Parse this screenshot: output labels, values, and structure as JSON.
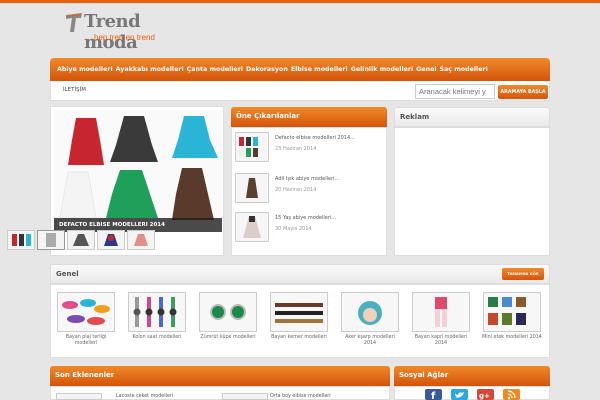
{
  "header": {
    "logo_title": "Trend moda",
    "logo_tagline": "hep tren en trend"
  },
  "nav": {
    "items": [
      "Abiye modelleri",
      "Ayakkabı modelleri",
      "Çanta modelleri",
      "Dekorasyon",
      "Elbise modelleri",
      "Gelinlik modelleri",
      "Genel",
      "Saç modelleri"
    ],
    "contact_label": "İLETİŞİM"
  },
  "search": {
    "placeholder": "Aranacak kelimeyi y",
    "button_label": "ARAMAYA BAŞLA"
  },
  "slider": {
    "caption": "DEFACTO ELBISE MODELLERI 2014"
  },
  "featured": {
    "heading": "Öne Çıkarılanlar",
    "items": [
      {
        "title": "Defacto elbise modelleri 2014...",
        "date": "23 Haziran 2014"
      },
      {
        "title": "Adil Işık abiye modelleri...",
        "date": "20 Haziran 2014"
      },
      {
        "title": "15 Yaş abiye modelleri...",
        "date": "30 Mayıs 2014"
      }
    ]
  },
  "ad": {
    "heading": "Reklam"
  },
  "genel": {
    "heading": "Genel",
    "all_button": "TAMAMINI GÖR",
    "items": [
      {
        "label": "Bayan plaj terliği modelleri"
      },
      {
        "label": "Kolon saat modelleri"
      },
      {
        "label": "Zümrüt küpe modelleri"
      },
      {
        "label": "Bayan kemer modelleri"
      },
      {
        "label": "Aker eşarp modelleri 2014"
      },
      {
        "label": "Bayan kapri modelleri 2014"
      },
      {
        "label": "Mini etek modelleri 2014"
      }
    ]
  },
  "latest": {
    "heading": "Son Eklenenler",
    "items": [
      {
        "title": "Lacoste ceket modelleri"
      },
      {
        "title": "Orta boy elbise modelleri"
      }
    ]
  },
  "social": {
    "heading": "Sosyal Ağlar",
    "items": [
      {
        "icon": "facebook-icon",
        "color": "#3b5998"
      },
      {
        "icon": "twitter-icon",
        "color": "#2ba9e1"
      },
      {
        "icon": "google-plus-icon",
        "color": "#d34836"
      },
      {
        "icon": "rss-icon",
        "color": "#f08a1c"
      }
    ]
  },
  "colors": {
    "accent": "#e8620a",
    "background": "#e6e6e6"
  }
}
